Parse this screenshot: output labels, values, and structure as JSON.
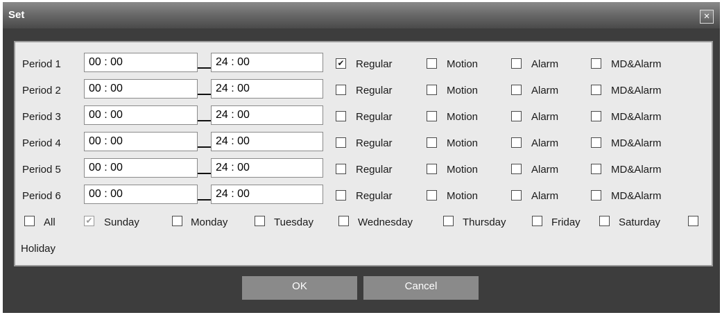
{
  "dialog": {
    "title": "Set",
    "close_icon": "×"
  },
  "periods": [
    {
      "label": "Period 1",
      "start": "00 : 00",
      "end": "24 : 00",
      "regular": true,
      "motion": false,
      "alarm": false,
      "md_alarm": false
    },
    {
      "label": "Period 2",
      "start": "00 : 00",
      "end": "24 : 00",
      "regular": false,
      "motion": false,
      "alarm": false,
      "md_alarm": false
    },
    {
      "label": "Period 3",
      "start": "00 : 00",
      "end": "24 : 00",
      "regular": false,
      "motion": false,
      "alarm": false,
      "md_alarm": false
    },
    {
      "label": "Period 4",
      "start": "00 : 00",
      "end": "24 : 00",
      "regular": false,
      "motion": false,
      "alarm": false,
      "md_alarm": false
    },
    {
      "label": "Period 5",
      "start": "00 : 00",
      "end": "24 : 00",
      "regular": false,
      "motion": false,
      "alarm": false,
      "md_alarm": false
    },
    {
      "label": "Period 6",
      "start": "00 : 00",
      "end": "24 : 00",
      "regular": false,
      "motion": false,
      "alarm": false,
      "md_alarm": false
    }
  ],
  "record_types": {
    "regular": "Regular",
    "motion": "Motion",
    "alarm": "Alarm",
    "md_alarm": "MD&Alarm"
  },
  "days": [
    {
      "label": "All",
      "checked": false,
      "disabled": false
    },
    {
      "label": "Sunday",
      "checked": true,
      "disabled": true
    },
    {
      "label": "Monday",
      "checked": false,
      "disabled": false
    },
    {
      "label": "Tuesday",
      "checked": false,
      "disabled": false
    },
    {
      "label": "Wednesday",
      "checked": false,
      "disabled": false
    },
    {
      "label": "Thursday",
      "checked": false,
      "disabled": false
    },
    {
      "label": "Friday",
      "checked": false,
      "disabled": false
    },
    {
      "label": "Saturday",
      "checked": false,
      "disabled": false
    },
    {
      "label": "Holiday",
      "checked": false,
      "disabled": false
    }
  ],
  "buttons": {
    "ok": "OK",
    "cancel": "Cancel"
  },
  "checkmark_glyph": "✔",
  "colors": {
    "titlebar": "#6a6a6a",
    "dialog_background": "#3d3d3d",
    "panel_background": "#eaeaea",
    "button": "#8a8a8a"
  }
}
